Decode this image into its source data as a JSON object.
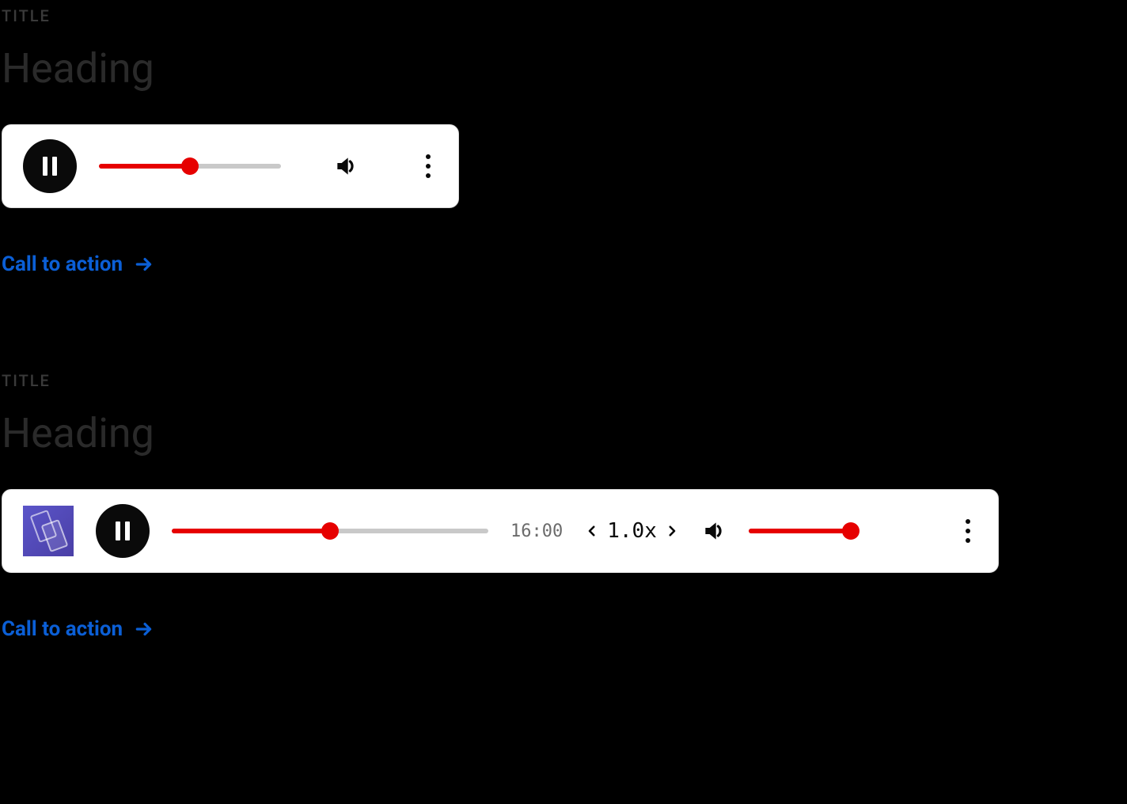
{
  "sections": [
    {
      "overline": "TITLE",
      "heading": "Heading",
      "cta": "Call to action",
      "player": {
        "progress_pct": 50
      }
    },
    {
      "overline": "TITLE",
      "heading": "Heading",
      "cta": "Call to action",
      "player": {
        "progress_pct": 50,
        "time": "16:00",
        "speed": "1.0x",
        "volume_pct": 92
      }
    }
  ],
  "colors": {
    "accent": "#e60000",
    "link": "#0b5fd6"
  }
}
